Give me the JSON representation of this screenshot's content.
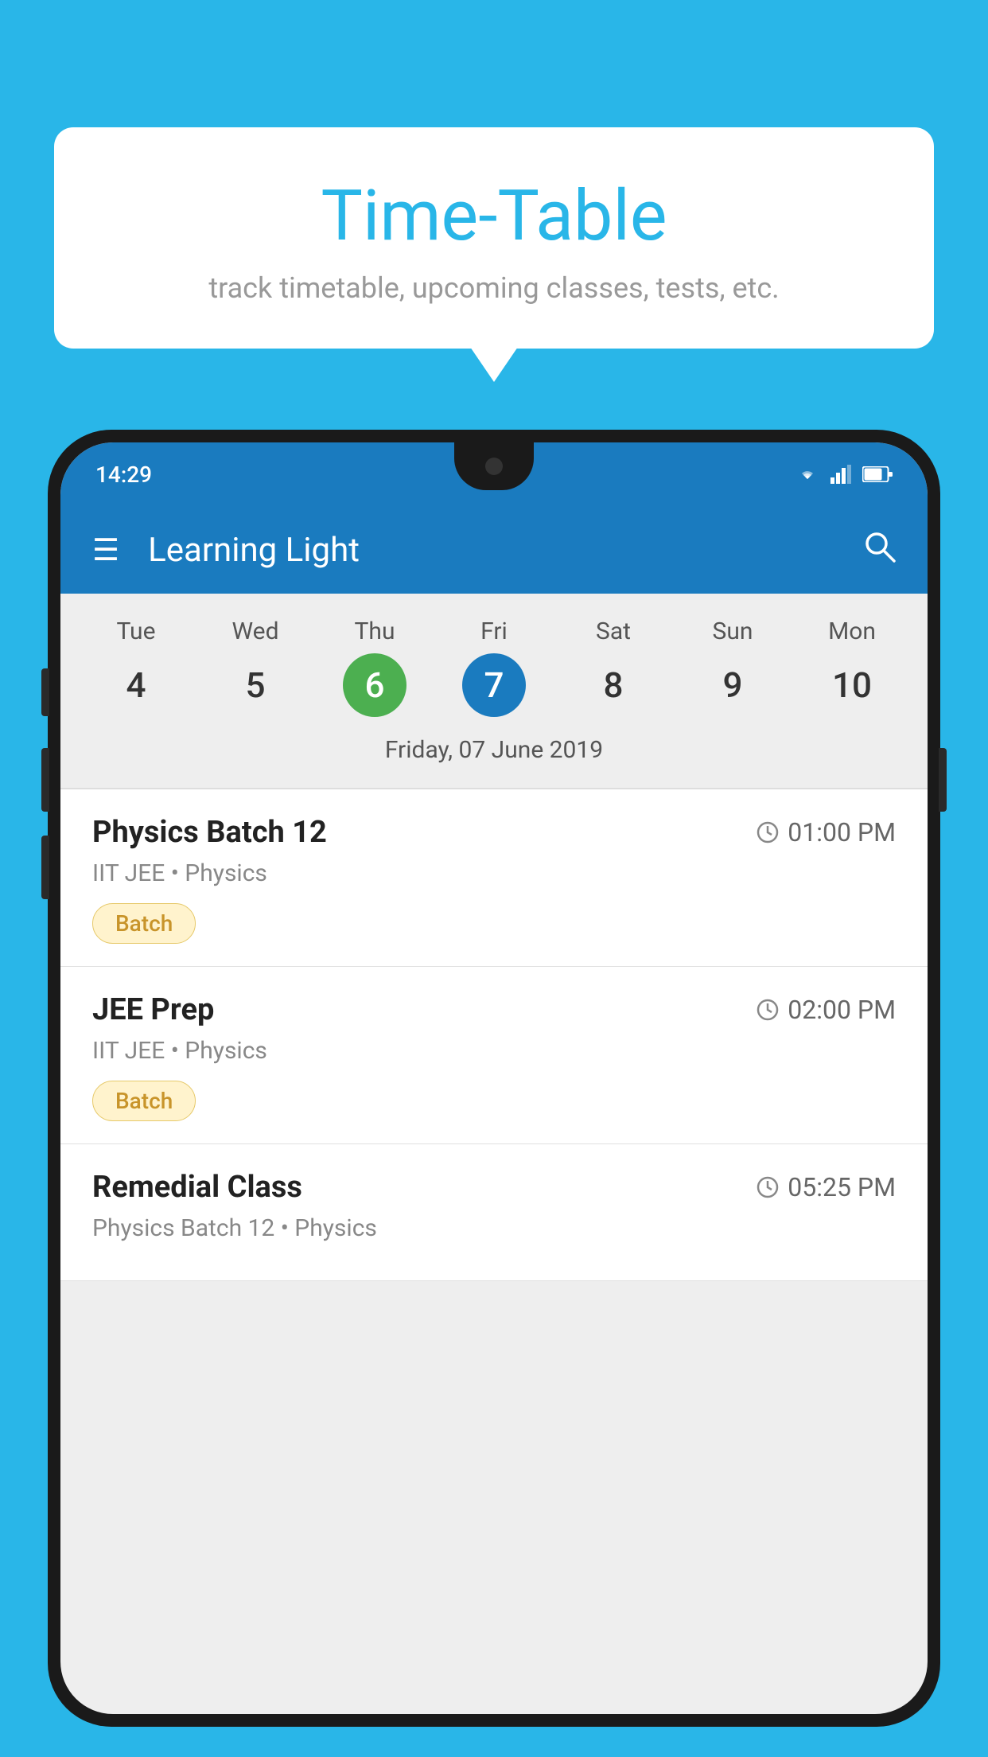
{
  "background": {
    "color": "#29b6e8"
  },
  "speech_bubble": {
    "title": "Time-Table",
    "subtitle": "track timetable, upcoming classes, tests, etc."
  },
  "phone": {
    "status_bar": {
      "time": "14:29"
    },
    "app_header": {
      "title": "Learning Light"
    },
    "calendar": {
      "days": [
        {
          "name": "Tue",
          "date": "4",
          "state": "normal"
        },
        {
          "name": "Wed",
          "date": "5",
          "state": "normal"
        },
        {
          "name": "Thu",
          "date": "6",
          "state": "today"
        },
        {
          "name": "Fri",
          "date": "7",
          "state": "selected"
        },
        {
          "name": "Sat",
          "date": "8",
          "state": "normal"
        },
        {
          "name": "Sun",
          "date": "9",
          "state": "normal"
        },
        {
          "name": "Mon",
          "date": "10",
          "state": "normal"
        }
      ],
      "selected_label": "Friday, 07 June 2019"
    },
    "schedule": [
      {
        "title": "Physics Batch 12",
        "time": "01:00 PM",
        "subtitle": "IIT JEE • Physics",
        "tag": "Batch"
      },
      {
        "title": "JEE Prep",
        "time": "02:00 PM",
        "subtitle": "IIT JEE • Physics",
        "tag": "Batch"
      },
      {
        "title": "Remedial Class",
        "time": "05:25 PM",
        "subtitle": "Physics Batch 12 • Physics",
        "tag": ""
      }
    ]
  }
}
